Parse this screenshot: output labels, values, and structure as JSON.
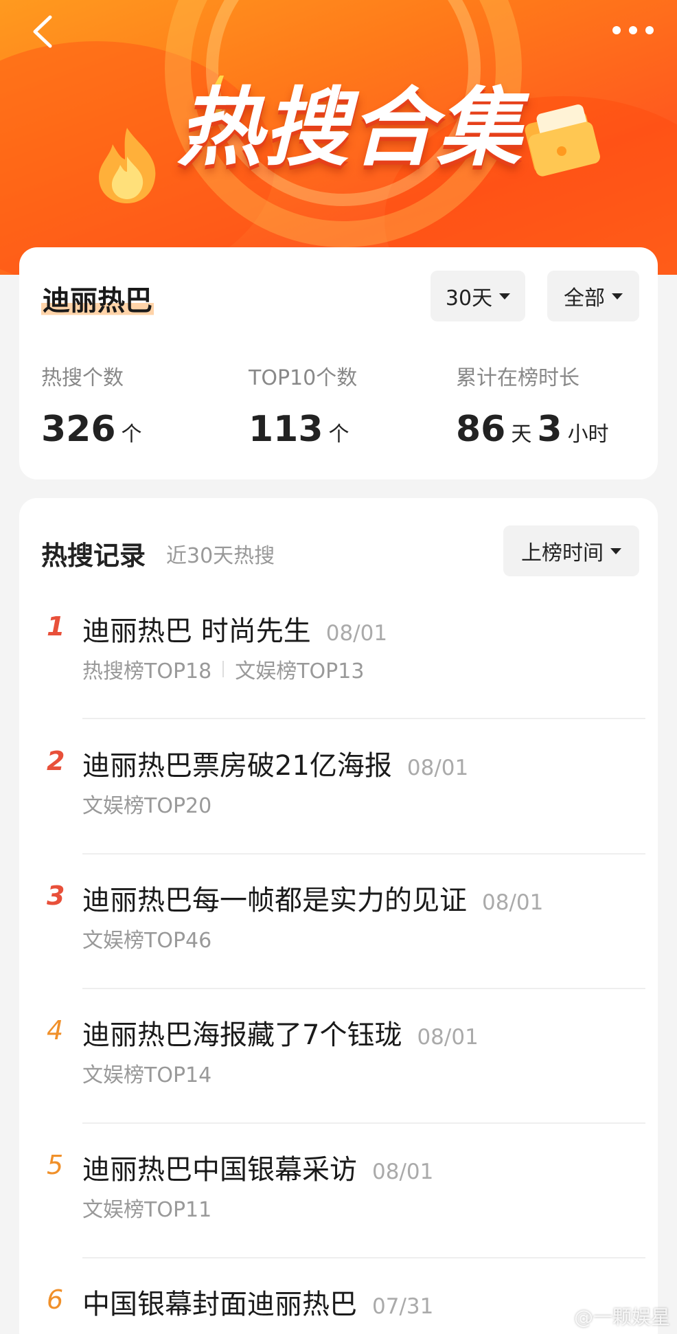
{
  "banner": {
    "title": "热搜合集"
  },
  "keyword": "迪丽热巴",
  "filters": {
    "days": "30天",
    "scope": "全部"
  },
  "stats": [
    {
      "label": "热搜个数",
      "value": "326",
      "unit": "个"
    },
    {
      "label": "TOP10个数",
      "value": "113",
      "unit": "个"
    },
    {
      "label": "累计在榜时长",
      "value_days": "86",
      "unit_days": "天",
      "value_hours": "3",
      "unit_hours": "小时"
    }
  ],
  "records": {
    "title": "热搜记录",
    "subtitle": "近30天热搜",
    "sort_label": "上榜时间",
    "items": [
      {
        "rank": "1",
        "title": "迪丽热巴 时尚先生",
        "date": "08/01",
        "tags": [
          "热搜榜TOP18",
          "文娱榜TOP13"
        ]
      },
      {
        "rank": "2",
        "title": "迪丽热巴票房破21亿海报",
        "date": "08/01",
        "tags": [
          "文娱榜TOP20"
        ]
      },
      {
        "rank": "3",
        "title": "迪丽热巴每一帧都是实力的见证",
        "date": "08/01",
        "tags": [
          "文娱榜TOP46"
        ]
      },
      {
        "rank": "4",
        "title": "迪丽热巴海报藏了7个钰珑",
        "date": "08/01",
        "tags": [
          "文娱榜TOP14"
        ]
      },
      {
        "rank": "5",
        "title": "迪丽热巴中国银幕采访",
        "date": "08/01",
        "tags": [
          "文娱榜TOP11"
        ]
      },
      {
        "rank": "6",
        "title": "中国银幕封面迪丽热巴",
        "date": "07/31",
        "tags": []
      }
    ]
  },
  "watermark": "@一颗娱星",
  "colors": {
    "rank_top3": "#e8503a",
    "rank_other": "#f0902a",
    "highlight": "#ffd3a8"
  }
}
